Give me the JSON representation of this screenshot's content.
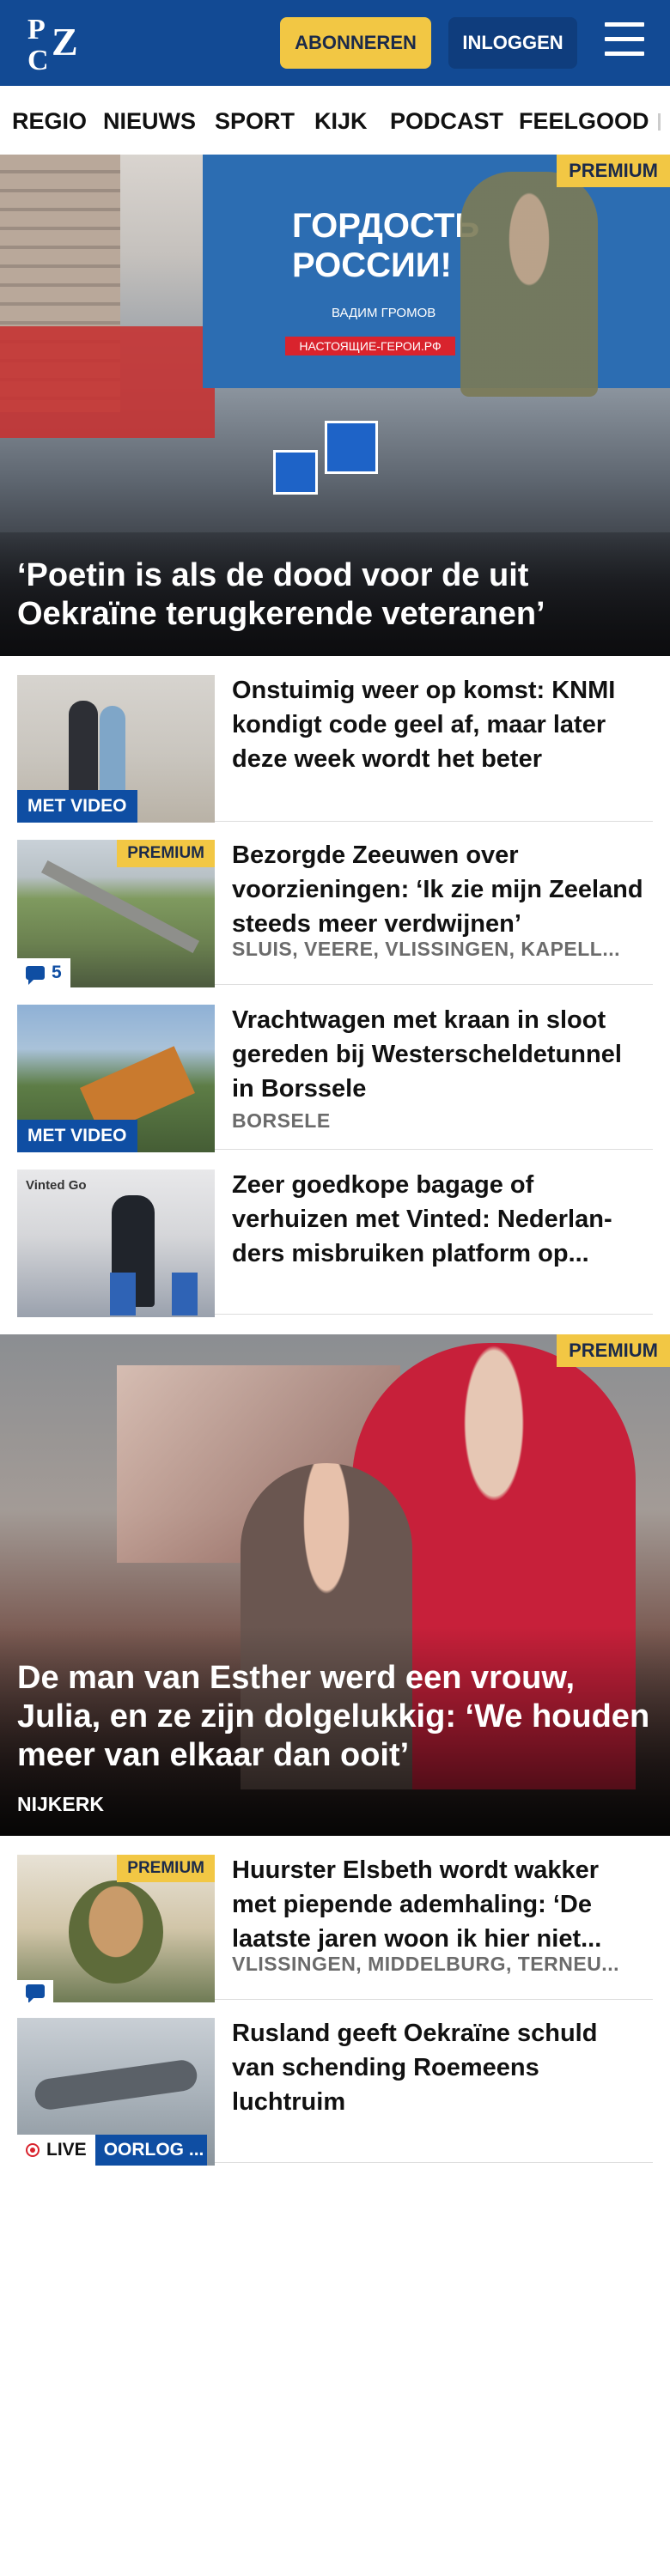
{
  "header": {
    "logo_letters": [
      "P",
      "Z",
      "C"
    ],
    "subscribe_label": "ABONNEREN",
    "login_label": "INLOGGEN",
    "brand_color": "#124a94",
    "accent_color": "#f2c744"
  },
  "nav": {
    "items": [
      "REGIO",
      "NIEUWS",
      "SPORT",
      "KIJK",
      "PODCAST",
      "FEELGOOD"
    ]
  },
  "hero": {
    "badge": "PREMIUM",
    "title": "‘Poetin is als de dood voor de uit Oekraïne terugkerende veteranen’",
    "billboard_text": "ГОРДОСТЬ РОССИИ!",
    "billboard_name": "ВАДИМ ГРОМОВ",
    "billboard_url": "НАСТОЯЩИЕ-ГЕРОИ.РФ"
  },
  "articles": [
    {
      "title": "Onstuimig weer op komst: KNMI kondigt code geel af, maar later deze week wordt het beter",
      "meta": "",
      "tag": "MET VIDEO"
    },
    {
      "title": "Bezorgde Zeeuwen over voorzieningen: ‘Ik zie mijn Zeeland steeds meer verdwijnen’",
      "meta": "SLUIS, VEERE, VLISSINGEN, KAPELL...",
      "badge": "PREMIUM",
      "comments": "5"
    },
    {
      "title": "Vrachtwagen met kraan in sloot gereden bij Westerscheldetunnel in Borssele",
      "meta": "BORSELE",
      "tag": "MET VIDEO"
    },
    {
      "title": "Zeer goedkope bagage of verhuizen met Vinted: Nederlan­ders misbruiken platform op...",
      "meta": "",
      "thumb_text": "Vinted Go"
    }
  ],
  "feature": {
    "badge": "PREMIUM",
    "title": "De man van Esther werd een vrouw, Julia, en ze zijn dolgelukkig: ‘We houden meer van elkaar dan ooit’",
    "location": "NIJKERK"
  },
  "articles2": [
    {
      "title": "Huurster Elsbeth wordt wakker met piepende ademhaling: ‘De laatste jaren woon ik hier niet...",
      "meta": "VLISSINGEN, MIDDELBURG, TERNEU...",
      "badge": "PREMIUM"
    },
    {
      "title": "Rusland geeft Oekraïne schuld van schending Roemeens luchtruim",
      "live_label": "LIVE",
      "topic_label": "OORLOG ..."
    }
  ]
}
